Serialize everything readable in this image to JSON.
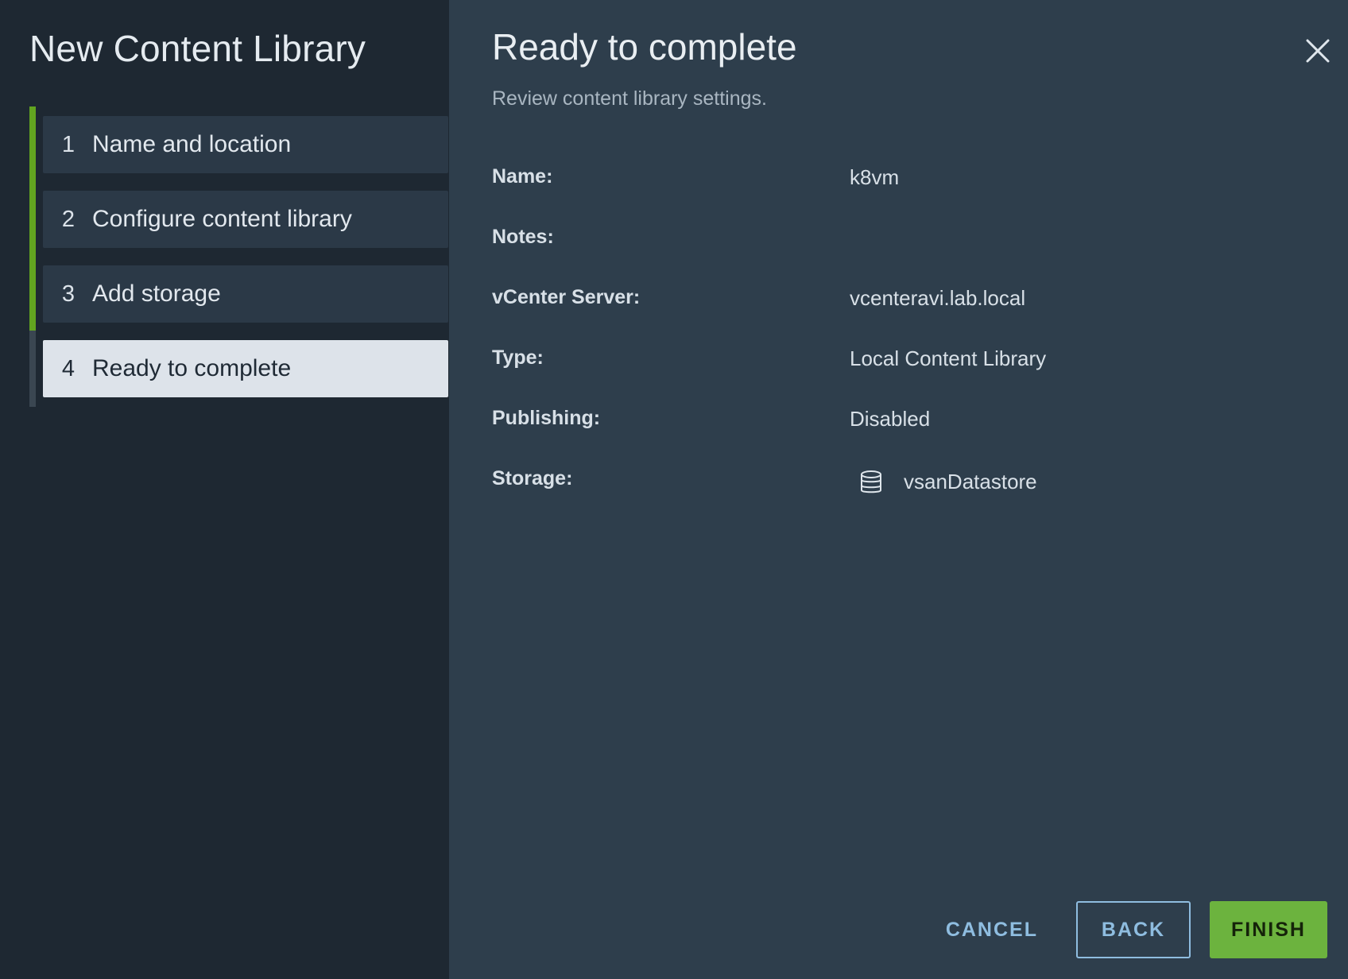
{
  "wizard": {
    "title": "New Content Library"
  },
  "steps": [
    {
      "number": "1",
      "label": "Name and location"
    },
    {
      "number": "2",
      "label": "Configure content library"
    },
    {
      "number": "3",
      "label": "Add storage"
    },
    {
      "number": "4",
      "label": "Ready to complete"
    }
  ],
  "main": {
    "title": "Ready to complete",
    "subtitle": "Review content library settings.",
    "review": {
      "name_label": "Name:",
      "name_value": "k8vm",
      "notes_label": "Notes:",
      "notes_value": "",
      "vcenter_label": "vCenter Server:",
      "vcenter_value": "vcenteravi.lab.local",
      "type_label": "Type:",
      "type_value": "Local Content Library",
      "publishing_label": "Publishing:",
      "publishing_value": "Disabled",
      "storage_label": "Storage:",
      "storage_value": "vsanDatastore",
      "storage_icon": "datastore-icon"
    }
  },
  "footer": {
    "cancel_label": "CANCEL",
    "back_label": "BACK",
    "finish_label": "FINISH"
  },
  "colors": {
    "nav_bg": "#1e2832",
    "content_bg": "#2e3e4c",
    "accent_green": "#62a420",
    "finish_green": "#6cb33e",
    "link_blue": "#8fbde0"
  }
}
